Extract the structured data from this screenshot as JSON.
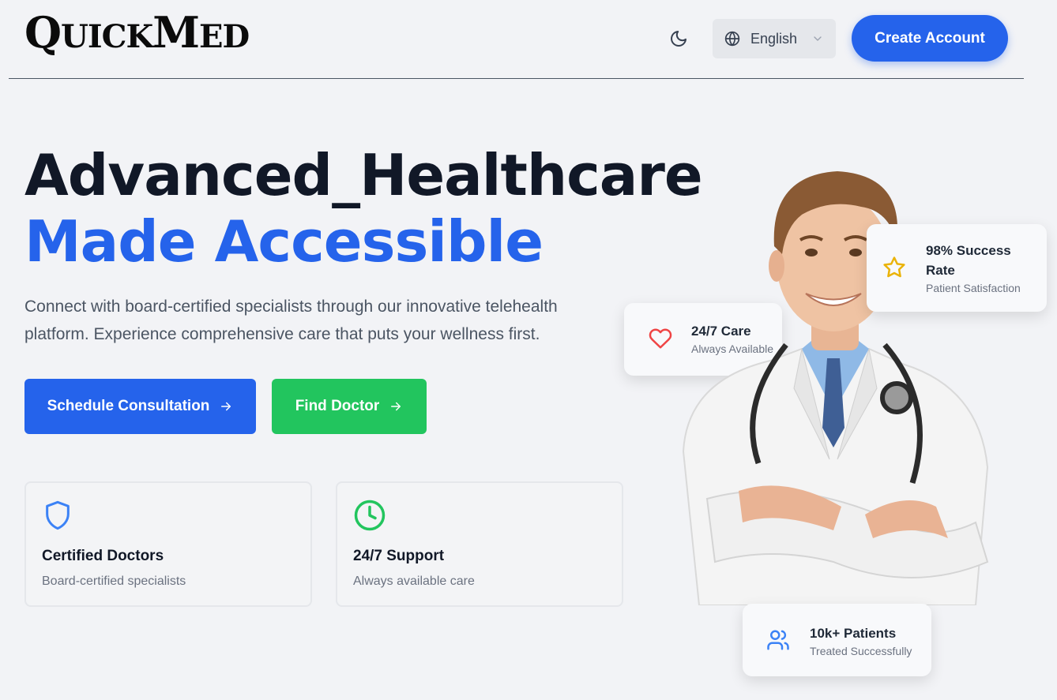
{
  "header": {
    "logo_big_q": "Q",
    "logo_small_1": "UICK",
    "logo_big_m": "M",
    "logo_small_2": "ED",
    "theme_icon": "moon-icon",
    "language": {
      "icon": "globe-icon",
      "selected": "English",
      "chevron": "chevron-down-icon"
    },
    "create_account": "Create Account"
  },
  "hero": {
    "title_line1": "Advanced_Healthcare",
    "title_line2": "Made Accessible",
    "description": "Connect with board-certified specialists through our innovative telehealth platform. Experience comprehensive care that puts your wellness first.",
    "buttons": {
      "schedule": "Schedule Consultation",
      "find": "Find Doctor",
      "arrow_icon": "arrow-right-icon"
    }
  },
  "features": [
    {
      "icon": "shield-icon",
      "title": "Certified Doctors",
      "subtitle": "Board-certified specialists"
    },
    {
      "icon": "clock-icon",
      "title": "24/7 Support",
      "subtitle": "Always available care"
    }
  ],
  "stat_cards": {
    "success": {
      "icon": "star-icon",
      "title_line1": "98% Success",
      "title_line2": "Rate",
      "subtitle": "Patient Satisfaction"
    },
    "care": {
      "icon": "heart-icon",
      "title": "24/7 Care",
      "subtitle": "Always Available"
    },
    "patients": {
      "icon": "users-icon",
      "title": "10k+ Patients",
      "subtitle": "Treated Successfully"
    }
  },
  "colors": {
    "primary": "#2563eb",
    "success_green": "#22c55e",
    "heart_red": "#ef4444",
    "star_yellow": "#eab308",
    "background": "#f2f3f6"
  }
}
